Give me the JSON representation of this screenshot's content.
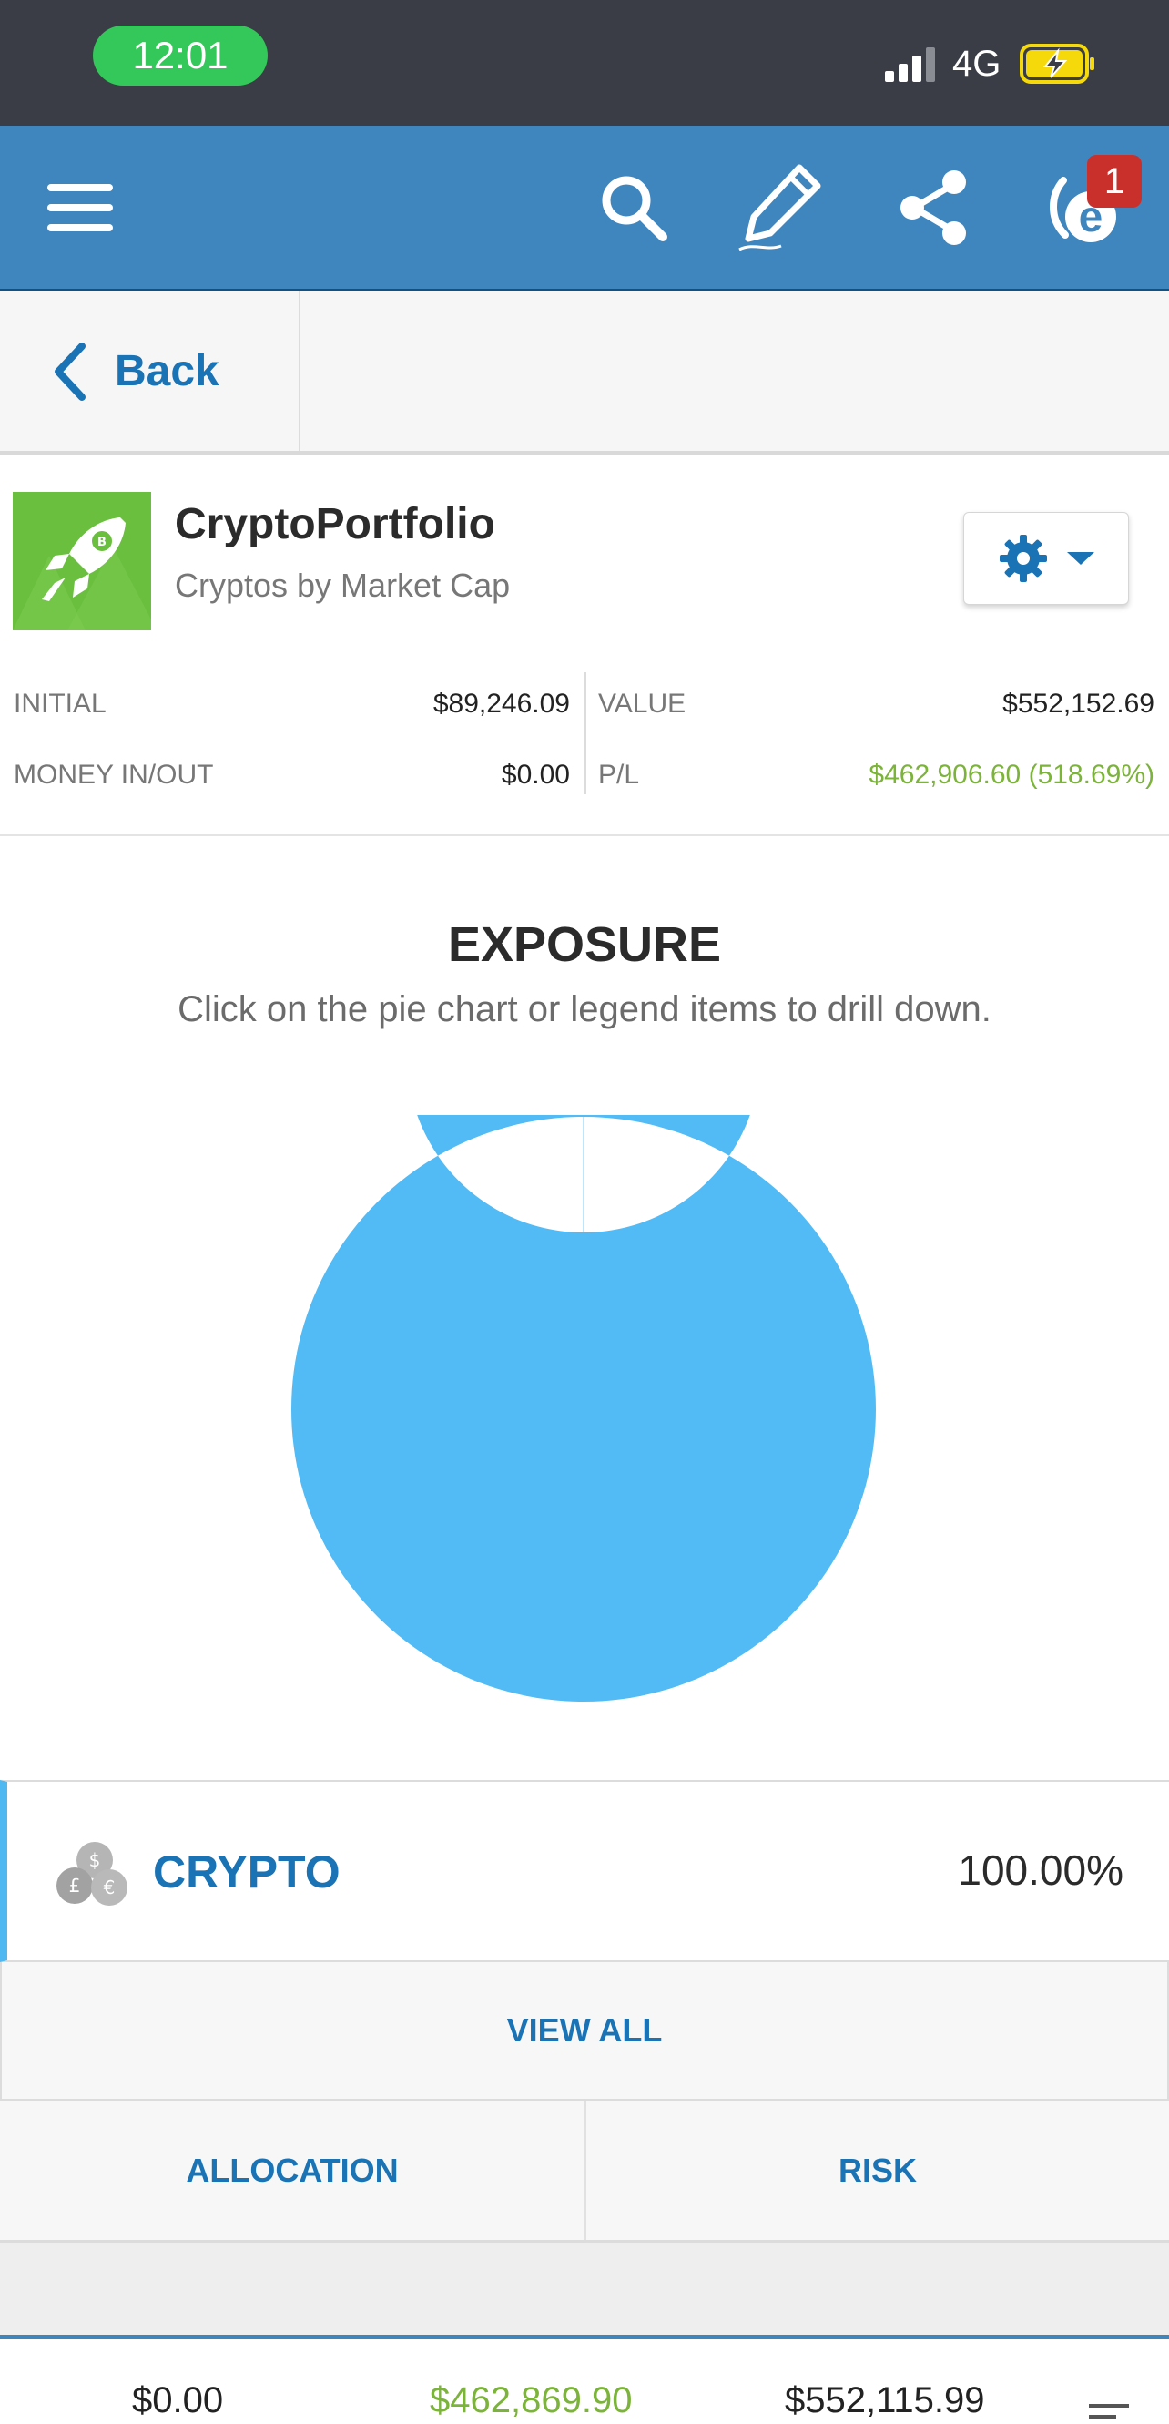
{
  "status_bar": {
    "time": "12:01",
    "network": "4G"
  },
  "app_bar": {
    "notification_count": "1",
    "icons": [
      "menu-icon",
      "search-icon",
      "edit-icon",
      "share-icon",
      "etoro-logo-icon"
    ]
  },
  "nav": {
    "back_label": "Back"
  },
  "portfolio": {
    "name": "CryptoPortfolio",
    "subtitle": "Cryptos by Market Cap",
    "stats": {
      "initial_label": "INITIAL",
      "initial_value": "$89,246.09",
      "money_label": "MONEY IN/OUT",
      "money_value": "$0.00",
      "value_label": "VALUE",
      "value_value": "$552,152.69",
      "pl_label": "P/L",
      "pl_value": "$462,906.60 (518.69%)"
    }
  },
  "exposure": {
    "title": "EXPOSURE",
    "subtitle": "Click on the pie chart or legend items to drill down.",
    "legend": [
      {
        "label": "CRYPTO",
        "value": "100.00%"
      }
    ],
    "view_all_label": "VIEW ALL"
  },
  "chart_data": {
    "type": "pie",
    "categories": [
      "CRYPTO"
    ],
    "values": [
      100.0
    ],
    "colors": [
      "#52bbf5"
    ]
  },
  "tabs": {
    "allocation": "ALLOCATION",
    "risk": "RISK"
  },
  "footer": {
    "v1": "$0.00",
    "v2": "$462,869.90",
    "v3": "$552,115.99"
  },
  "colors": {
    "app_bar": "#3f86bf",
    "accent_blue": "#1a73b5",
    "positive_green": "#7cb33b",
    "chart_blue": "#52bbf5"
  }
}
